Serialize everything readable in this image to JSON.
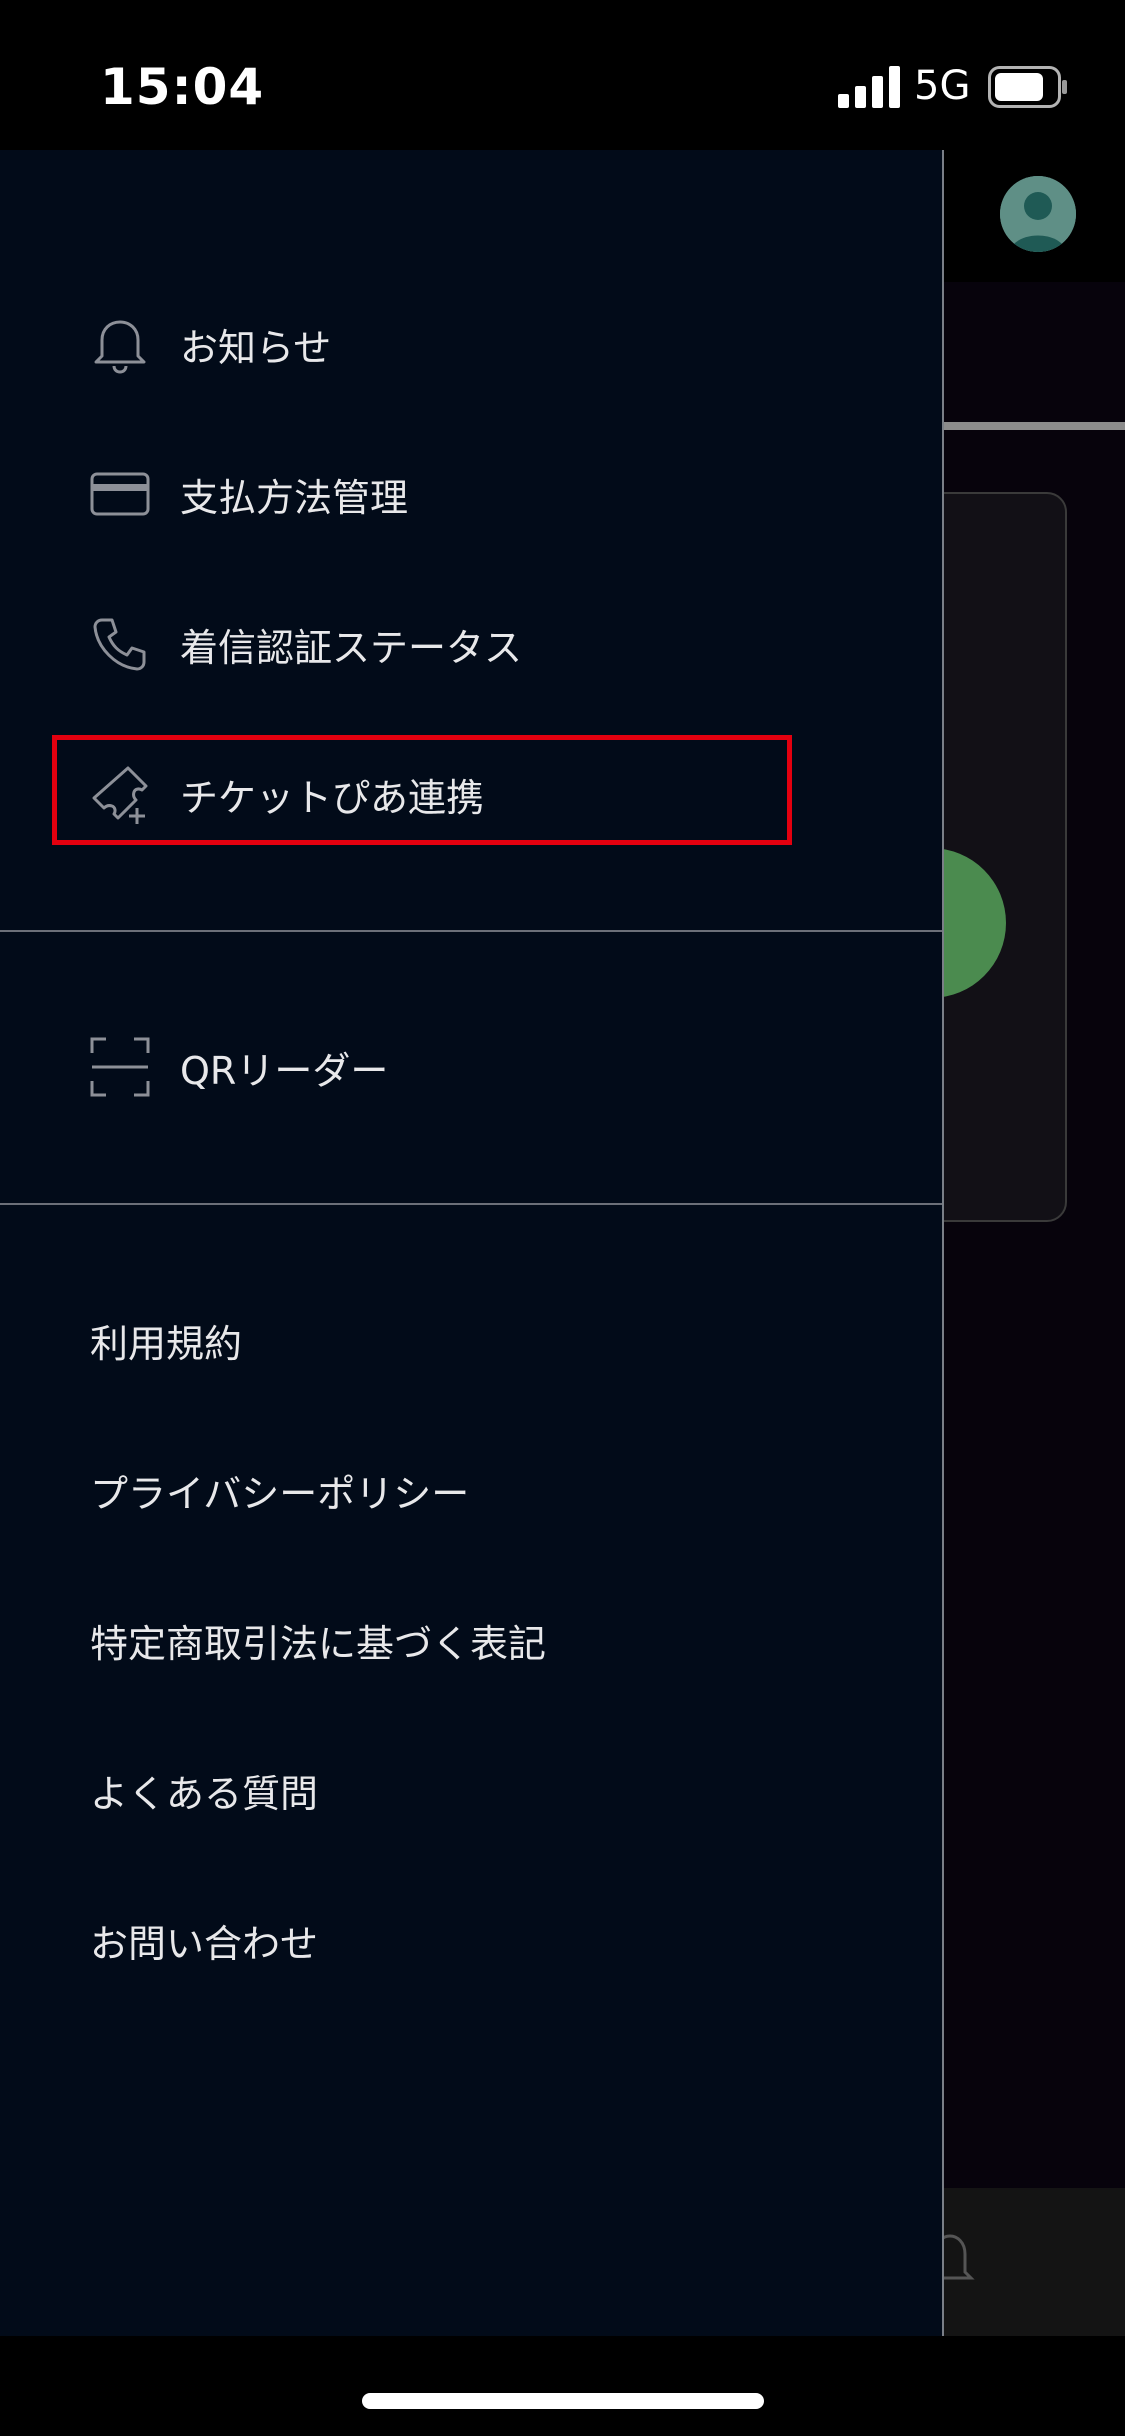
{
  "status_bar": {
    "time": "15:04",
    "network": "5G",
    "signal_icon": "signal-bars-icon",
    "battery_icon": "battery-icon",
    "battery_level": 0.8
  },
  "background": {
    "avatar_icon": "user-avatar-icon",
    "tab_icon": "bell-icon"
  },
  "drawer": {
    "primary_items": [
      {
        "label": "お知らせ",
        "icon": "bell-icon"
      },
      {
        "label": "支払方法管理",
        "icon": "credit-card-icon"
      },
      {
        "label": "着信認証ステータス",
        "icon": "phone-icon"
      },
      {
        "label": "チケットぴあ連携",
        "icon": "ticket-add-icon",
        "highlighted": true
      }
    ],
    "tool_items": [
      {
        "label": "QRリーダー",
        "icon": "qr-scan-icon"
      }
    ],
    "links": [
      {
        "label": "利用規約"
      },
      {
        "label": "プライバシーポリシー"
      },
      {
        "label": "特定商取引法に基づく表記"
      },
      {
        "label": "よくある質問"
      },
      {
        "label": "お問い合わせ"
      }
    ]
  },
  "colors": {
    "drawer_bg": "#020b19",
    "text": "#e8e8ea",
    "icon": "#8d9098",
    "highlight": "#e3000f",
    "avatar": "#5f8f86",
    "accent_circle": "#4b8b4f"
  }
}
